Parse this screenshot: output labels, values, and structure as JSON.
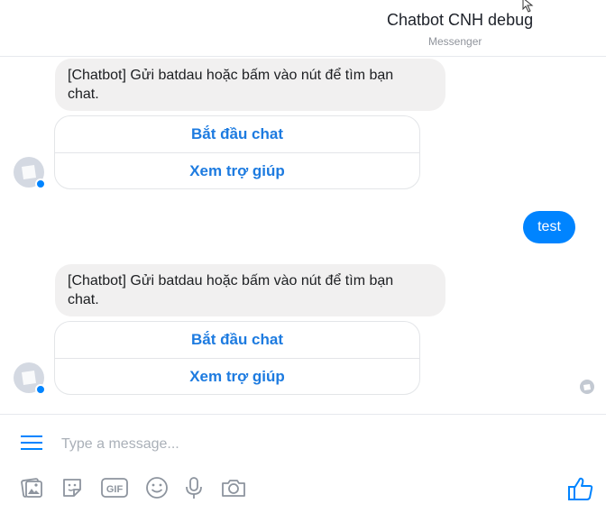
{
  "header": {
    "title": "Chatbot CNH debug",
    "subtitle": "Messenger"
  },
  "messages": {
    "bot1": {
      "line1": "[Chatbot] Gửi batdau hoặc bấm vào nút để tìm bạn",
      "line2": "chat.",
      "buttons": [
        "Bắt đầu chat",
        "Xem trợ giúp"
      ]
    },
    "user1": {
      "text": "test"
    },
    "bot2": {
      "line1": "[Chatbot] Gửi batdau hoặc bấm vào nút để tìm bạn",
      "line2": "chat.",
      "buttons": [
        "Bắt đầu chat",
        "Xem trợ giúp"
      ]
    }
  },
  "composer": {
    "placeholder": "Type a message...",
    "icons": [
      "menu-icon",
      "image-icon",
      "sticker-icon",
      "gif-icon",
      "emoji-icon",
      "microphone-icon",
      "camera-icon",
      "thumbs-up-icon"
    ],
    "gif_label": "GIF"
  },
  "colors": {
    "accent": "#0084ff",
    "button_text": "#1d7be0",
    "bot_bubble": "#f1f0f0"
  }
}
